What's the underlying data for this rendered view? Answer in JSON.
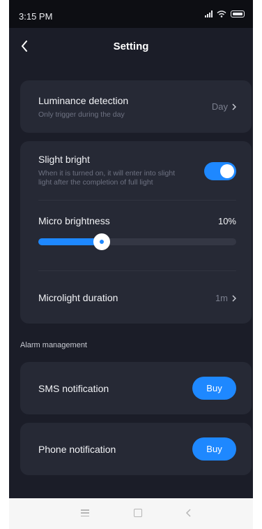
{
  "status_bar": {
    "time": "3:15 PM"
  },
  "header": {
    "title": "Setting"
  },
  "luminance": {
    "title": "Luminance detection",
    "subtitle": "Only trigger during the day",
    "value": "Day"
  },
  "slight_bright": {
    "title": "Slight bright",
    "description_line1": "When it is turned on, it will enter into slight",
    "description_line2": "light after the completion of full light",
    "enabled": true
  },
  "micro_brightness": {
    "label": "Micro brightness",
    "value_text": "10%",
    "level": 0.32
  },
  "microlight_duration": {
    "label": "Microlight duration",
    "value": "1m"
  },
  "alarm_section": {
    "title": "Alarm management"
  },
  "sms": {
    "label": "SMS notification",
    "button": "Buy"
  },
  "phone": {
    "label": "Phone notification",
    "button": "Buy"
  },
  "colors": {
    "accent": "#1e88ff",
    "background": "#1b1d28",
    "card": "#262935"
  }
}
